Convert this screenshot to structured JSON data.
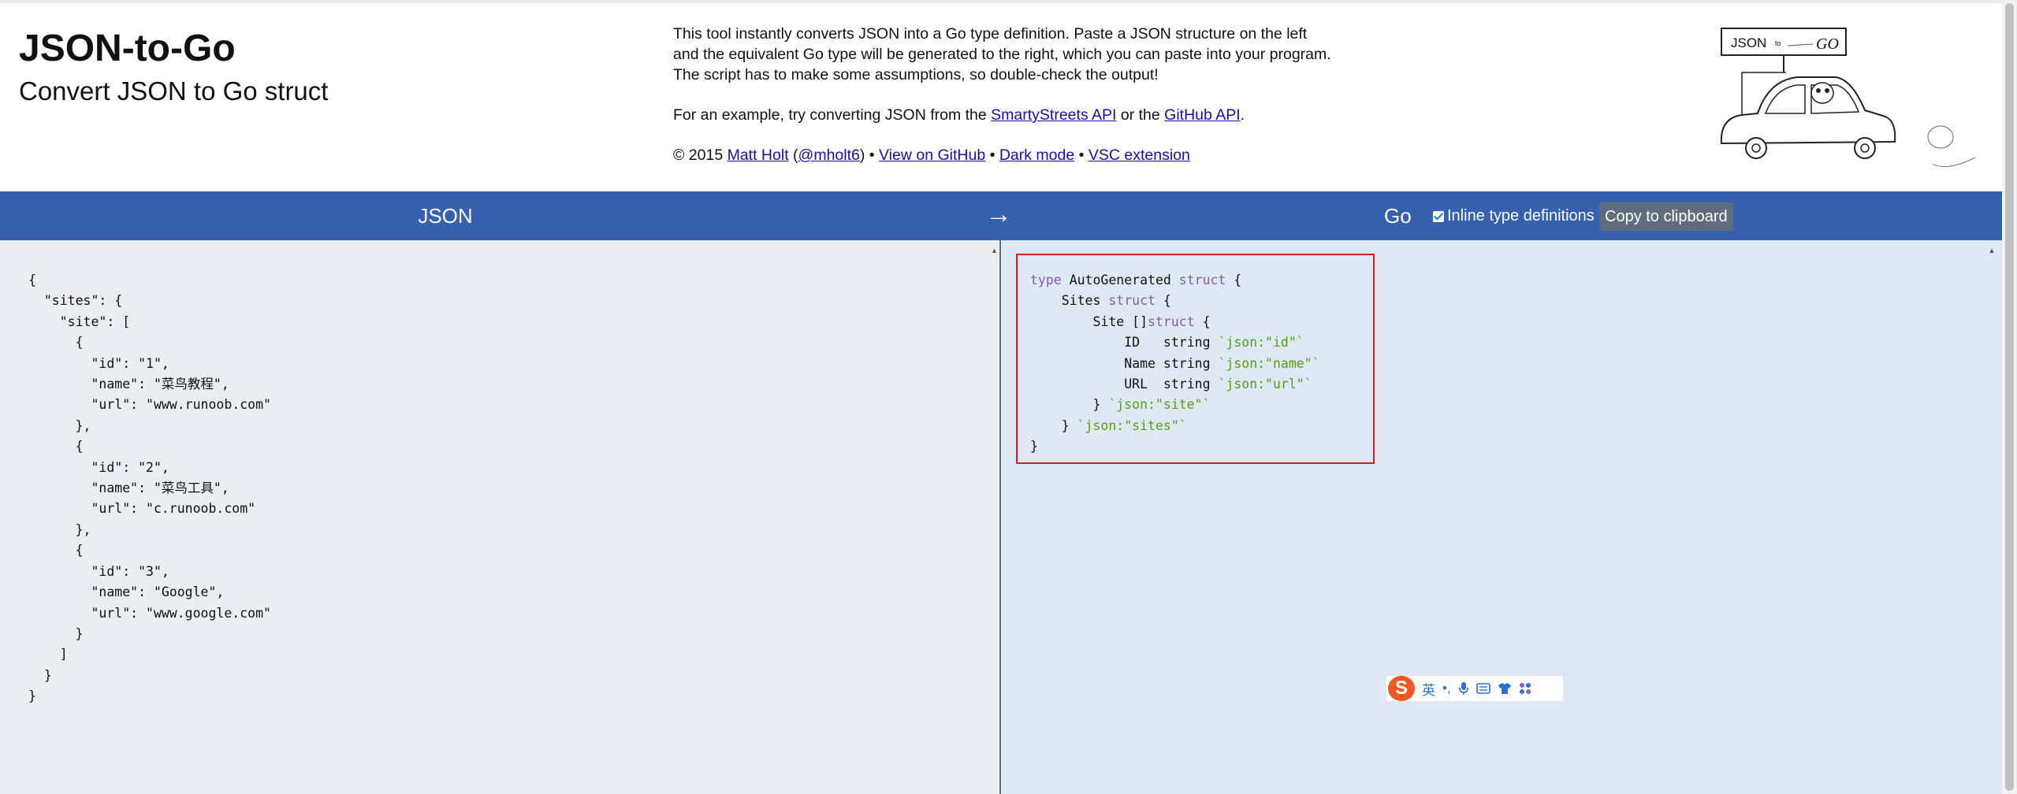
{
  "header": {
    "title": "JSON-to-Go",
    "subtitle": "Convert JSON to Go struct",
    "intro": "This tool instantly converts JSON into a Go type definition. Paste a JSON structure on the left and the equivalent Go type will be generated to the right, which you can paste into your program. The script has to make some assumptions, so double-check the output!",
    "example_prefix": "For an example, try converting JSON from the ",
    "example_link1": "SmartyStreets API",
    "example_mid": " or the ",
    "example_link2": "GitHub API",
    "example_suffix": ".",
    "copyright": "© 2015 ",
    "author_link": "Matt Holt",
    "handle_open": " (",
    "handle_link": "@mholt6",
    "handle_close": ") • ",
    "github_link": "View on GitHub",
    "sep1": " • ",
    "dark_link": "Dark mode",
    "sep2": " • ",
    "vsc_link": "VSC extension",
    "logo_text_json": "JSON",
    "logo_text_to": "to",
    "logo_text_go": "GO"
  },
  "toolbar": {
    "json_label": "JSON",
    "arrow": "→",
    "go_label": "Go",
    "inline_label": "Inline type definitions",
    "inline_checked": true,
    "copy_label": "Copy to clipboard",
    "bar_color": "#3661ae"
  },
  "json_input": "{\n  \"sites\": {\n    \"site\": [\n      {\n        \"id\": \"1\",\n        \"name\": \"菜鸟教程\",\n        \"url\": \"www.runoob.com\"\n      },\n      {\n        \"id\": \"2\",\n        \"name\": \"菜鸟工具\",\n        \"url\": \"c.runoob.com\"\n      },\n      {\n        \"id\": \"3\",\n        \"name\": \"Google\",\n        \"url\": \"www.google.com\"\n      }\n    ]\n  }\n}",
  "go_output": {
    "type_kw": "type",
    "type_name": "AutoGenerated",
    "struct_kw": "struct",
    "sites_field": "Sites",
    "site_field": "Site",
    "slice": "[]",
    "fields": [
      {
        "name": "ID",
        "type": "string",
        "tag": "`json:\"id\"`"
      },
      {
        "name": "Name",
        "type": "string",
        "tag": "`json:\"name\"`"
      },
      {
        "name": "URL",
        "type": "string",
        "tag": "`json:\"url\"`"
      }
    ],
    "site_tag": "`json:\"site\"`",
    "sites_tag": "`json:\"sites\"`"
  },
  "ime_bar": {
    "logo": "S",
    "lang": "英",
    "punct": "•,",
    "icons": [
      "microphone-icon",
      "keyboard-icon",
      "skin-icon",
      "grid-icon"
    ]
  }
}
